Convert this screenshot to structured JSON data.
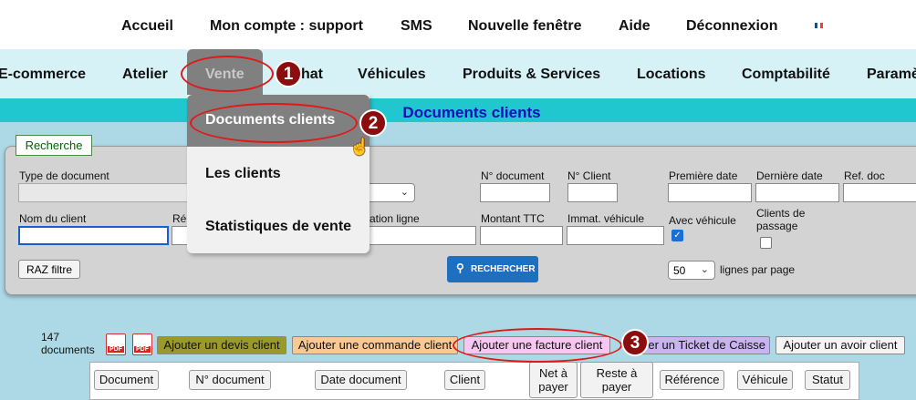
{
  "topbar": {
    "items": [
      "Accueil",
      "Mon compte : support",
      "SMS",
      "Nouvelle fenêtre",
      "Aide",
      "Déconnexion"
    ],
    "flag_colors": [
      "#0055a4",
      "#ffffff",
      "#ef4135"
    ]
  },
  "navbar": {
    "items": [
      "E-commerce",
      "Atelier",
      "Vente",
      "hat",
      "Véhicules",
      "Produits & Services",
      "Locations",
      "Comptabilité",
      "Paramè"
    ]
  },
  "page_title": "Documents clients",
  "vente_menu": {
    "items": [
      "Documents clients",
      "Les clients",
      "Statistiques de vente"
    ]
  },
  "search": {
    "title": "Recherche",
    "labels": {
      "type_document": "Type de document",
      "num_document": "N° document",
      "num_client": "N° Client",
      "premiere_date": "Première date",
      "derniere_date": "Dernière date",
      "ref_doc": "Ref. doc",
      "nom_client": "Nom du client",
      "re": "Ré",
      "designation": "ation ligne",
      "montant_ttc": "Montant TTC",
      "immat": "Immat. véhicule",
      "avec_vehicule": "Avec véhicule",
      "clients_passage_1": "Clients de",
      "clients_passage_2": "passage"
    },
    "avec_vehicule_checked": true,
    "clients_passage_checked": false,
    "raz_label": "RAZ filtre",
    "search_label": "RECHERCHER",
    "lines_value": "50",
    "lines_label": "lignes par page"
  },
  "documents": {
    "count": "147",
    "count_label": "documents",
    "buttons": [
      {
        "label": "Ajouter un devis client",
        "color": "#9a9a2a"
      },
      {
        "label": "Ajouter une commande client",
        "color": "#fac890"
      },
      {
        "label": "Ajouter une facture client",
        "color": "#f7c7f2"
      },
      {
        "label": "er un Ticket de Caisse",
        "color": "#c8b4f0"
      },
      {
        "label": "Ajouter un avoir client",
        "color": "#f4f4f4"
      }
    ],
    "columns": [
      "Document",
      "N° document",
      "Date document",
      "Client",
      "Net à payer",
      "Reste à payer",
      "Référence",
      "Véhicule",
      "Statut"
    ]
  },
  "annotations": [
    "1",
    "2",
    "3"
  ]
}
